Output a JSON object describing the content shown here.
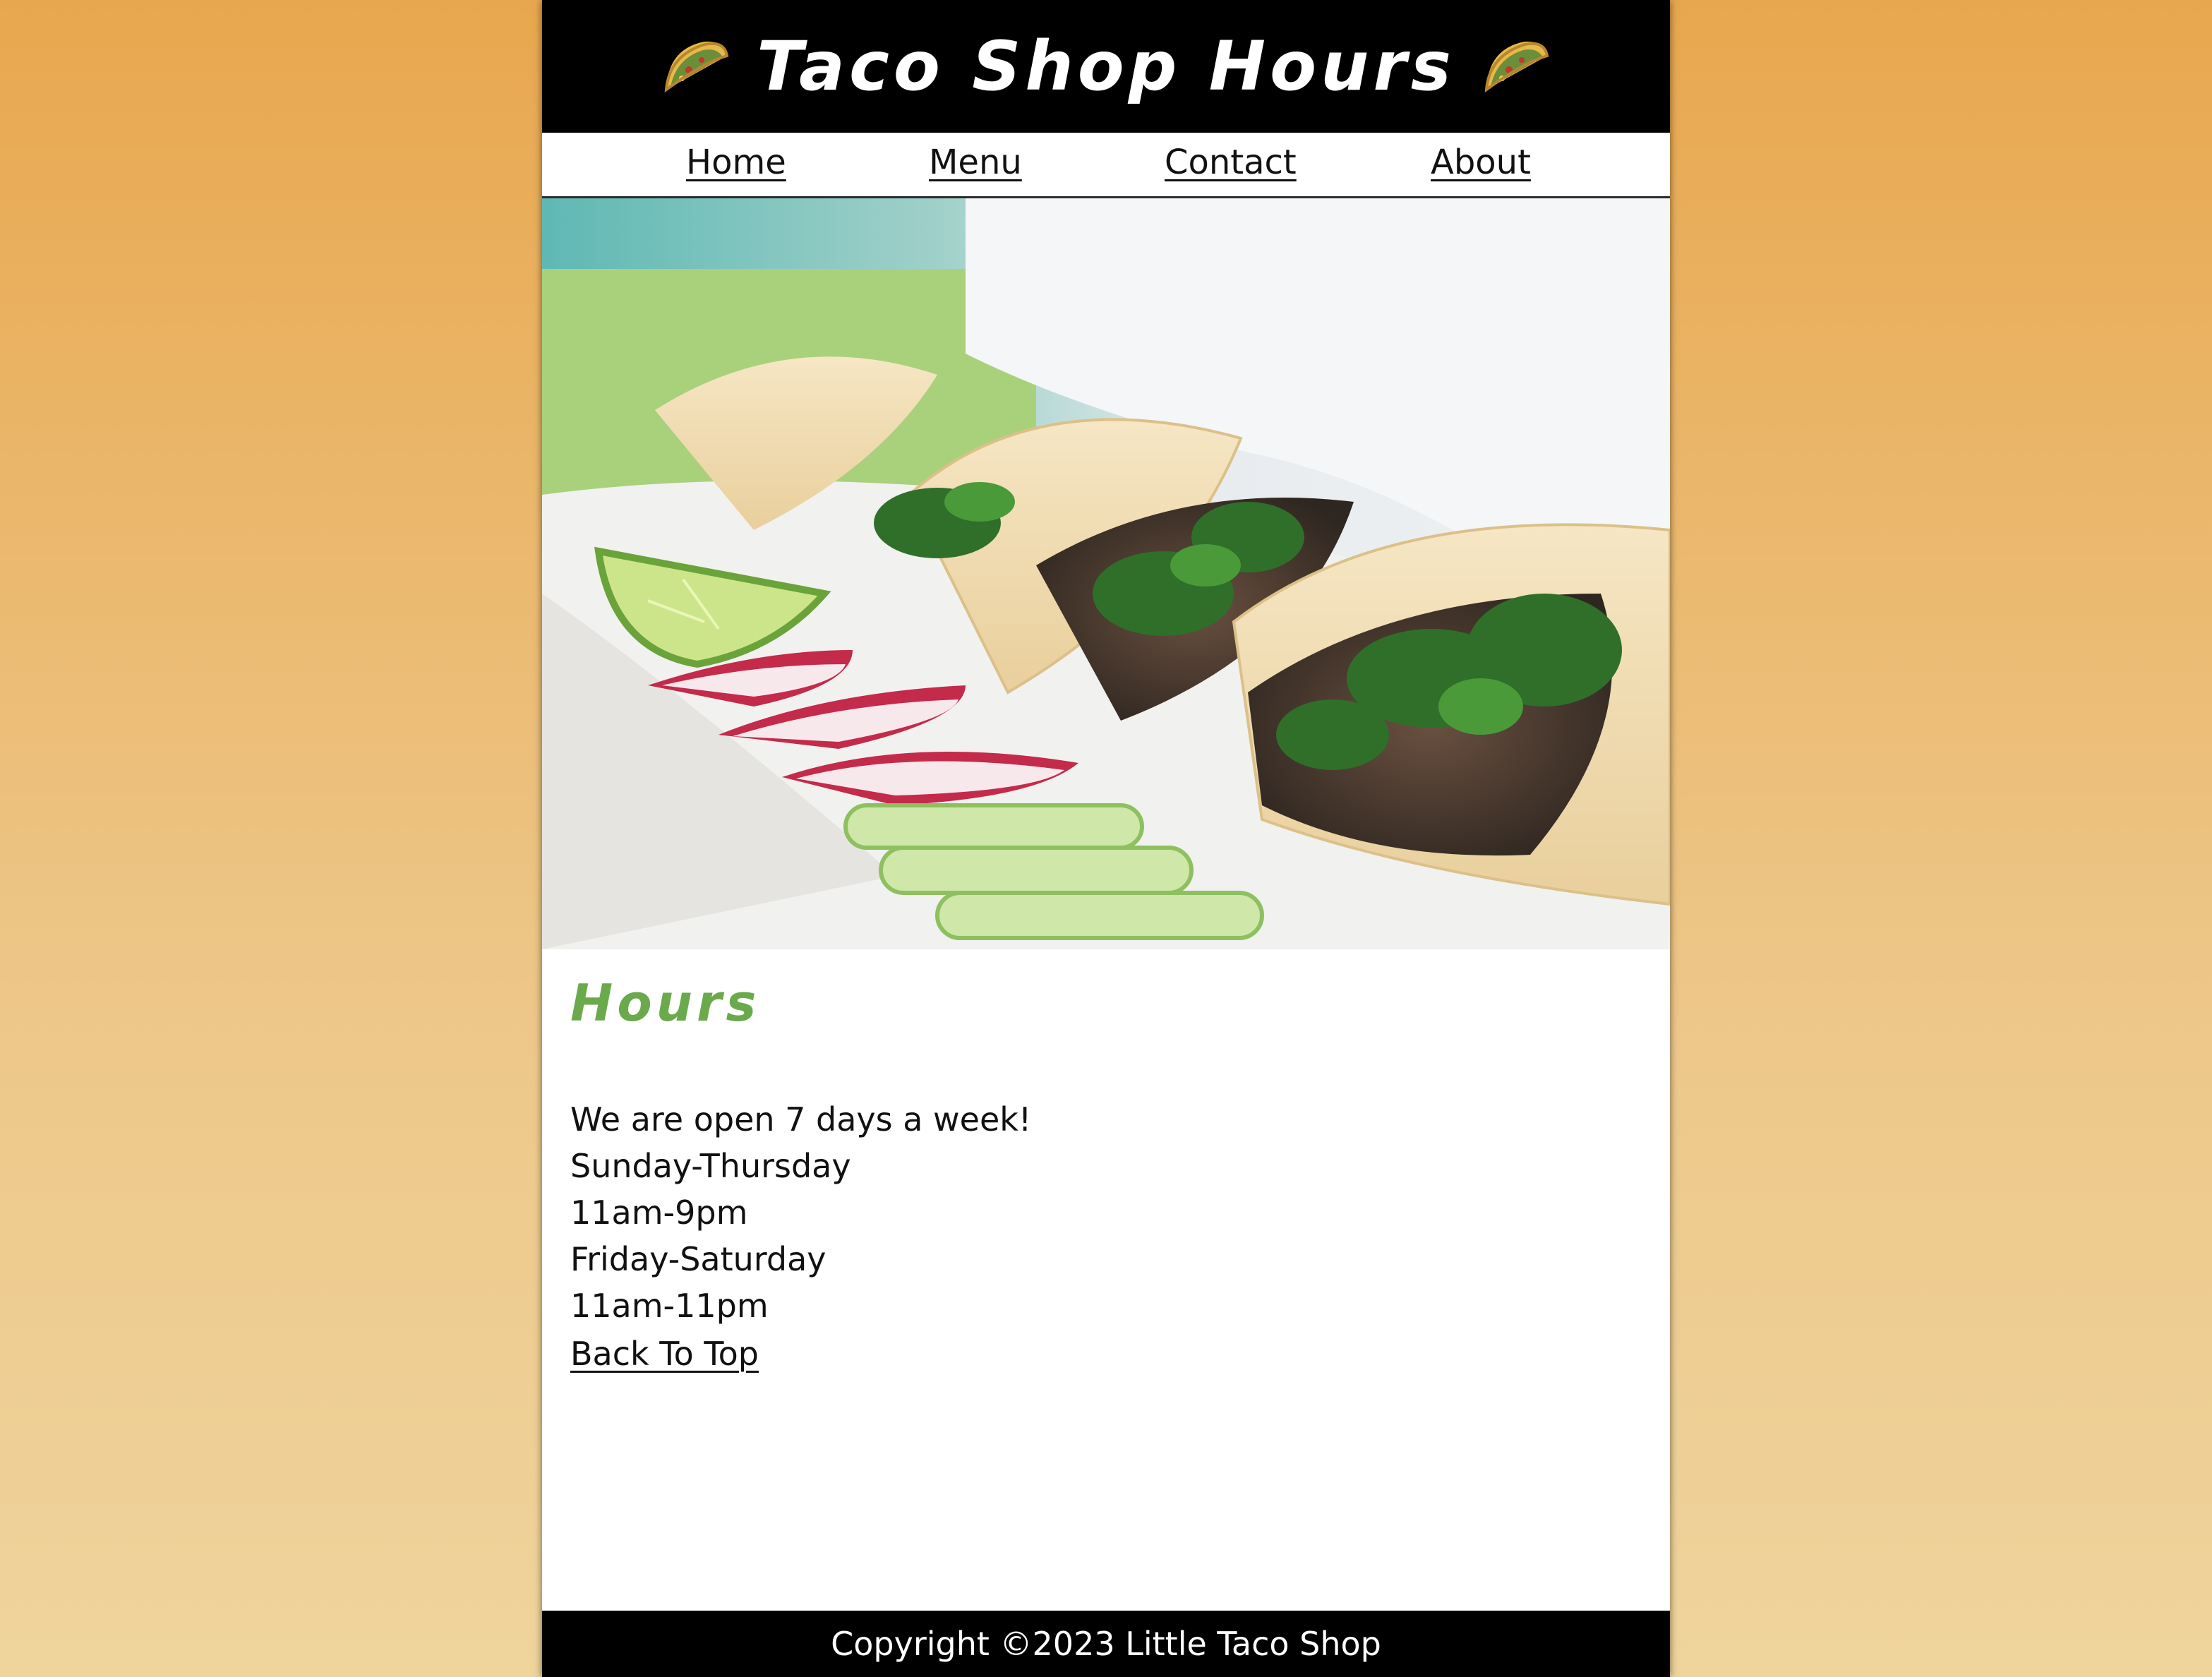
{
  "colors": {
    "header_bg": "#000000",
    "heading_green": "#6aaa4c",
    "background_orange": "#e8a74e"
  },
  "header": {
    "title": "Taco Shop Hours",
    "left_icon": "taco-icon",
    "right_icon": "taco-icon"
  },
  "nav": {
    "items": [
      {
        "label": "Home"
      },
      {
        "label": "Menu"
      },
      {
        "label": "Contact"
      },
      {
        "label": "About"
      }
    ]
  },
  "hero": {
    "image": "tacos-photo"
  },
  "main": {
    "heading": "Hours",
    "lines": [
      "We are open 7 days a week!",
      "Sunday-Thursday",
      "11am-9pm",
      "Friday-Saturday",
      "11am-11pm"
    ],
    "back_to_top": "Back To Top"
  },
  "footer": {
    "copyright": "Copyright ©2023 Little Taco Shop"
  }
}
